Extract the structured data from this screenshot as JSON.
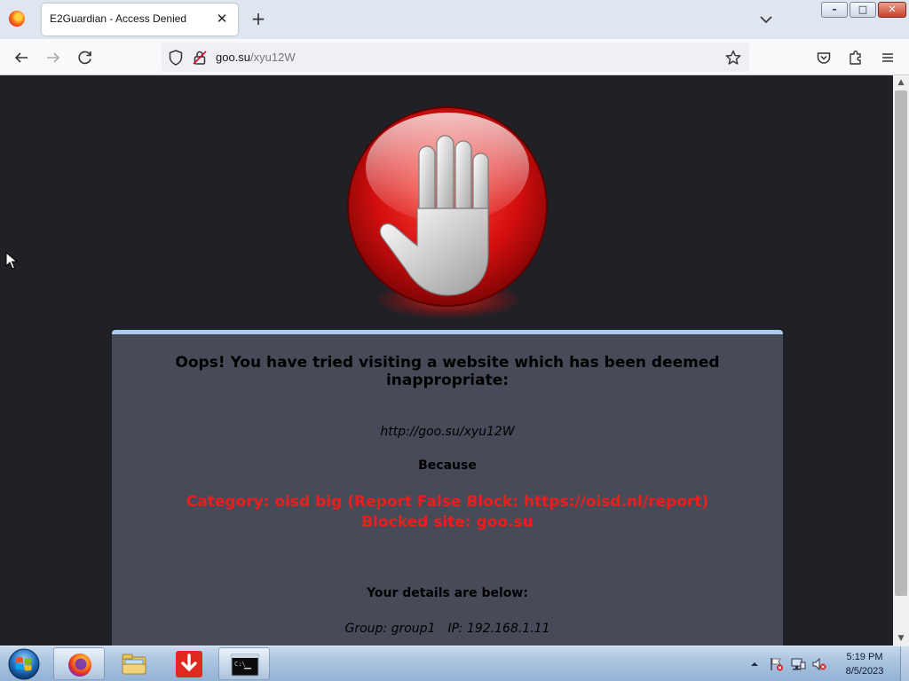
{
  "browser": {
    "tab": {
      "title": "E2Guardian - Access Denied",
      "close_glyph": "✕"
    },
    "new_tab_glyph": "+",
    "url": {
      "domain": "goo.su",
      "path": "/xyu12W"
    },
    "icons": [
      "firefox-icon",
      "back-icon",
      "forward-icon",
      "reload-icon",
      "shield-icon",
      "lock-icon",
      "star-icon",
      "pocket-icon",
      "extensions-icon",
      "menu-icon",
      "list-tabs-icon"
    ],
    "window_buttons": {
      "minimize": "–",
      "maximize": "□",
      "close": "✕"
    }
  },
  "page": {
    "title": "Oops! You have tried visiting a website which has been deemed inappropriate:",
    "blocked_url": "http://goo.su/xyu12W",
    "because_label": "Because",
    "category": "Category: oisd big (Report False Block: https://oisd.nl/report)",
    "blocked_site": "Blocked site: goo.su",
    "details_heading": "Your details are below:",
    "group": "Group: group1",
    "ip": "IP: 192.168.1.11",
    "colors": {
      "background": "#1f2127",
      "panel": "#474b58",
      "panel_border": "#a8ccef",
      "alert_text": "#ee1c1c"
    }
  },
  "taskbar": {
    "items": [
      "start-orb-icon",
      "firefox-icon",
      "file-explorer-icon",
      "download-icon",
      "command-prompt-icon"
    ],
    "clock": {
      "time": "5:19 PM",
      "date": "8/5/2023"
    },
    "tray": [
      "show-hidden-icons-arrow",
      "action-center-flag-icon",
      "network-icon",
      "volume-muted-icon"
    ]
  }
}
